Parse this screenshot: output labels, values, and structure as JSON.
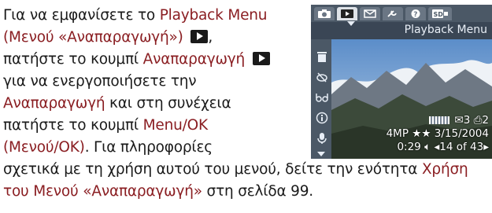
{
  "intro": {
    "l1a": "Για να εμφανίσετε το ",
    "l1b": "Playback Menu",
    "l2a": "(Μενού «Αναπαραγωγή»)",
    "l2b": ",",
    "l3a": "πατήστε το κουμπί ",
    "l3b": "Αναπαραγωγή",
    "l4": "για να ενεργοποιήσετε την",
    "l5a": "Αναπαραγωγή",
    "l5b": " και στη συνέχεια",
    "l6a": "πατήστε το κουμπί ",
    "l6b": "Menu/OK",
    "l7a": "(Μενού/OK)",
    "l7b": ". Για πληροφορίες"
  },
  "bottom": {
    "l1a": "σχετικά με τη χρήση αυτού του μενού, δείτε την ενότητα ",
    "l1b": "Χρήση",
    "l2a": "του Μενού «Αναπαραγωγή»",
    "l2b": " στη σελίδα 99."
  },
  "screen": {
    "menu_title": "Playback Menu",
    "tabs": [
      "camera-icon",
      "playback-icon",
      "share-icon",
      "setup-icon",
      "help-icon",
      "sd-card-icon"
    ],
    "sidebar": [
      "delete-icon",
      "remove-red-eye-icon",
      "glasses-icon",
      "info-icon",
      "record-audio-icon"
    ],
    "info": {
      "bar": "",
      "share_count": "3",
      "print_count": "2",
      "resolution": "4MP ★★",
      "date": "3/15/2004",
      "duration": "0:29",
      "counter": "14 of 43"
    },
    "colors": {
      "highlight": "#8a1e22",
      "screen_bg": "#3a4655",
      "sky": "#7aa7d6"
    }
  }
}
